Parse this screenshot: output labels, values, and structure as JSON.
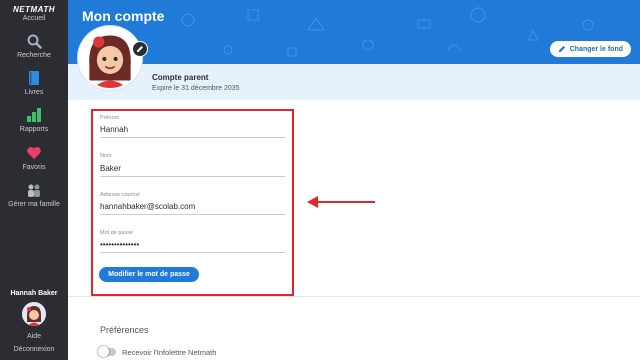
{
  "sidebar": {
    "logo": "NETMATH",
    "items": [
      {
        "label": "Accueil",
        "icon": "home-icon"
      },
      {
        "label": "Recherche",
        "icon": "search-icon"
      },
      {
        "label": "Livres",
        "icon": "book-icon"
      },
      {
        "label": "Rapports",
        "icon": "bar-chart-icon"
      },
      {
        "label": "Favoris",
        "icon": "heart-icon"
      },
      {
        "label": "Gérer ma famille",
        "icon": "family-icon"
      }
    ],
    "user_name": "Hannah Baker",
    "help_label": "Aide",
    "logout_label": "Déconnexion"
  },
  "header": {
    "title": "Mon compte",
    "change_background_label": "Changer le fond",
    "accent_color": "#1f7ad8"
  },
  "account": {
    "type": "Compte parent",
    "expiry": "Expire le 31 décembre 2035"
  },
  "form": {
    "first_name_label": "Prénom",
    "first_name_value": "Hannah",
    "last_name_label": "Nom",
    "last_name_value": "Baker",
    "email_label": "Adresse courriel",
    "email_value": "hannahbaker@scolab.com",
    "password_label": "Mot de passe",
    "password_value": "••••••••••••••",
    "change_password_label": "Modifier le mot de passe",
    "highlight_color": "#e3262e"
  },
  "preferences": {
    "title": "Préférences",
    "newsletter_label": "Recevoir l'Infolettre Netmath",
    "newsletter_enabled": false
  }
}
